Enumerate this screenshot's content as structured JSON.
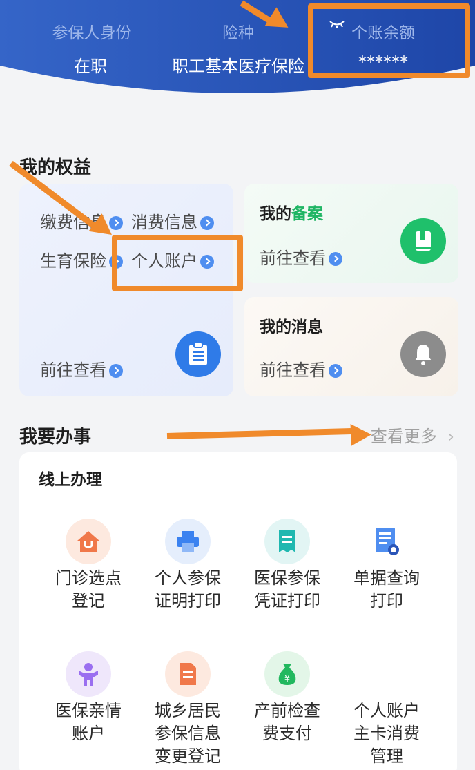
{
  "header": {
    "col1": {
      "label": "参保人身份",
      "value": "在职"
    },
    "col2": {
      "label": "险种",
      "value": "职工基本医疗保险"
    },
    "col3": {
      "label": "个账余额",
      "value": "******"
    }
  },
  "benefits": {
    "title": "我的权益",
    "links": [
      "缴费信息",
      "消费信息",
      "生育保险",
      "个人账户"
    ],
    "go_label": "前往查看",
    "filing": {
      "title_prefix": "我的",
      "title_highlight": "备案",
      "go_label": "前往查看"
    },
    "messages": {
      "title": "我的消息",
      "go_label": "前往查看"
    }
  },
  "tasks": {
    "title": "我要办事",
    "more": "查看更多",
    "online_title": "线上办理",
    "items": [
      {
        "line1": "门诊选点",
        "line2": "登记",
        "line3": "",
        "icon": "house-icon"
      },
      {
        "line1": "个人参保",
        "line2": "证明打印",
        "line3": "",
        "icon": "printer-icon"
      },
      {
        "line1": "医保参保",
        "line2": "凭证打印",
        "line3": "",
        "icon": "receipt-icon"
      },
      {
        "line1": "单据查询",
        "line2": "打印",
        "line3": "",
        "icon": "document-search-icon"
      },
      {
        "line1": "医保亲情",
        "line2": "账户",
        "line3": "",
        "icon": "family-icon"
      },
      {
        "line1": "城乡居民",
        "line2": "参保信息",
        "line3": "变更登记",
        "icon": "file-edit-icon"
      },
      {
        "line1": "产前检查",
        "line2": "费支付",
        "line3": "",
        "icon": "money-bag-icon"
      },
      {
        "line1": "个人账户",
        "line2": "主卡消费",
        "line3": "管理",
        "icon": "card-icon"
      }
    ]
  },
  "colors": {
    "header_blue": "#2a55b8",
    "accent_orange": "#f08a2b",
    "link_blue": "#4f8ef0",
    "green": "#1fb564"
  }
}
